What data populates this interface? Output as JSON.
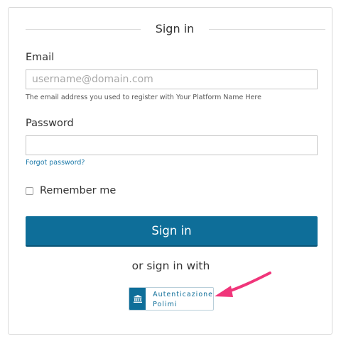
{
  "form": {
    "title": "Sign in",
    "email_label": "Email",
    "email_placeholder": "username@domain.com",
    "email_value": "",
    "email_help": "The email address you used to register with Your Platform Name Here",
    "password_label": "Password",
    "password_value": "",
    "forgot_password": "Forgot password?",
    "remember_label": "Remember me",
    "remember_checked": false,
    "submit_label": "Sign in",
    "alt_signin_text": "or sign in with"
  },
  "sso": {
    "line1": "Autenticazione",
    "line2": "Polimi",
    "icon": "institution-icon"
  },
  "colors": {
    "primary": "#0e6e99",
    "annotation_arrow": "#f0357a"
  }
}
